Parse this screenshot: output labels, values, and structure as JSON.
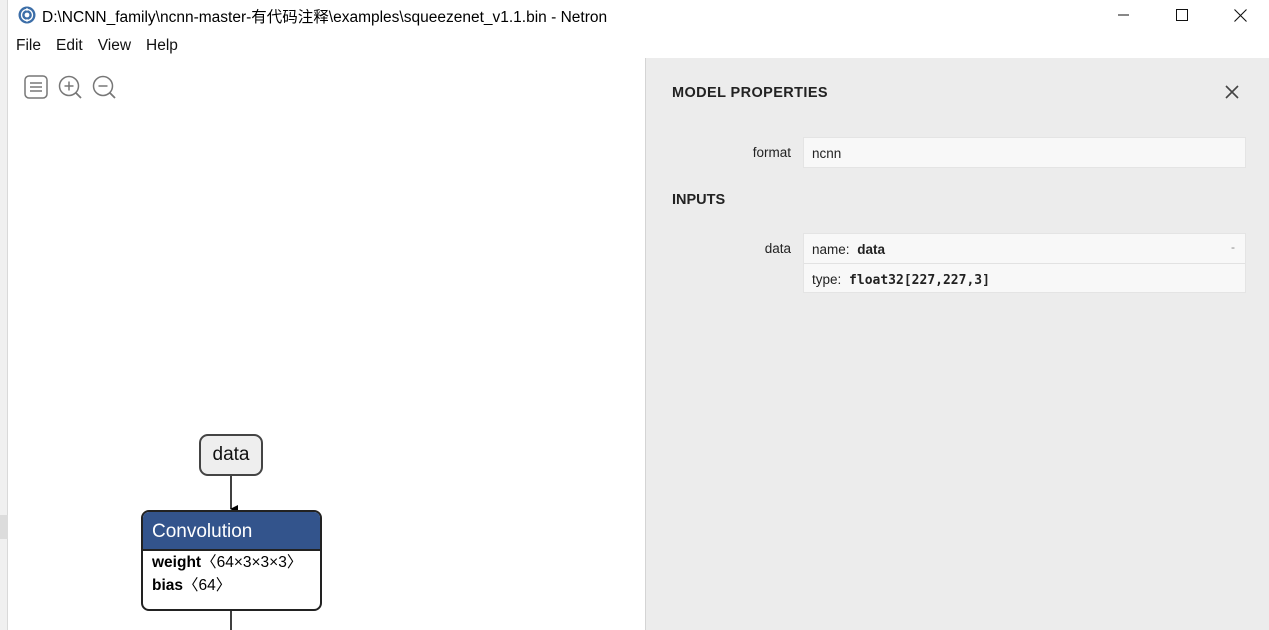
{
  "window": {
    "title": "D:\\NCNN_family\\ncnn-master-有代码注释\\examples\\squeezenet_v1.1.bin - Netron",
    "icon": "netron-app-icon"
  },
  "menu": [
    "File",
    "Edit",
    "View",
    "Help"
  ],
  "toolbar": [
    "sidebar-menu-icon",
    "zoom-in-icon",
    "zoom-out-icon"
  ],
  "graph": {
    "input_node": "data",
    "conv_node": {
      "title": "Convolution",
      "color": "#33548c",
      "attrs": [
        {
          "name": "weight",
          "value": "〈64×3×3×3〉"
        },
        {
          "name": "bias",
          "value": "〈64〉"
        }
      ]
    }
  },
  "panel": {
    "title": "MODEL PROPERTIES",
    "format_label": "format",
    "format_value": "ncnn",
    "inputs_title": "INPUTS",
    "input_label": "data",
    "name_prefix": "name:",
    "name_value": "data",
    "dash": "-",
    "type_prefix": "type:",
    "type_value": "float32[227,227,3]"
  }
}
